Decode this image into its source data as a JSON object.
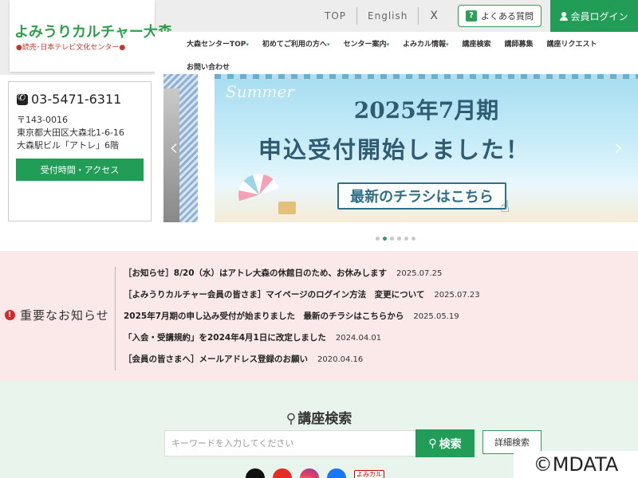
{
  "header": {
    "logo_text": "よみうりカルチャー大森",
    "logo_sub": "●読売･日本テレビ文化センター●",
    "top_links": [
      "TOP",
      "English"
    ],
    "x_icon": "X",
    "faq_label": "よくある質問",
    "faq_icon": "?",
    "login_label": "会員ログイン"
  },
  "nav": {
    "items": [
      {
        "label": "大森センターTOP",
        "caret": "▾"
      },
      {
        "label": "初めてご利用の方へ",
        "caret": "▾"
      },
      {
        "label": "センター案内",
        "caret": "▾"
      },
      {
        "label": "よみカル情報",
        "caret": "▾"
      },
      {
        "label": "講座検索",
        "caret": ""
      },
      {
        "label": "講師募集",
        "caret": ""
      },
      {
        "label": "講座リクエスト",
        "caret": ""
      },
      {
        "label": "お問い合わせ",
        "caret": ""
      }
    ]
  },
  "contact": {
    "phone": "03-5471-6311",
    "postal": "〒143-0016",
    "address1": "東京都大田区大森北1-6-16",
    "address2": "大森駅ビル「アトレ」6階",
    "access_label": "受付時間・アクセス"
  },
  "slider": {
    "summer": "Summer",
    "title1": "2025年7月期",
    "title2": "申込受付開始しました！",
    "flyer_label": "最新のチラシはこちら",
    "prev_arrow": "‹",
    "next_arrow": "›",
    "dot_count": 6,
    "active_dot": 1
  },
  "notices": {
    "heading": "重要なお知らせ",
    "alert_icon": "!",
    "items": [
      {
        "text": "［お知らせ］8/20（水）はアトレ大森の休館日のため、お休みします",
        "date": "2025.07.25"
      },
      {
        "text": "［よみうりカルチャー会員の皆さま］マイページのログイン方法　変更について",
        "date": "2025.07.23"
      },
      {
        "text": "2025年7月期の申し込み受付が始まりました　最新のチラシはこちらから",
        "date": "2025.05.19"
      },
      {
        "text": "「入会・受講規約」を2024年4月1日に改定しました",
        "date": "2024.04.01"
      },
      {
        "text": "［会員の皆さまへ］メールアドレス登録のお願い",
        "date": "2020.04.16"
      }
    ]
  },
  "search": {
    "title": "講座検索",
    "placeholder": "キーワードを入力してください",
    "button_label": "検索",
    "advanced_label": "詳細検索",
    "magnifier": "🔍"
  },
  "social": {
    "yomikaru_label": "よみカル"
  },
  "watermark": "©MDATA"
}
